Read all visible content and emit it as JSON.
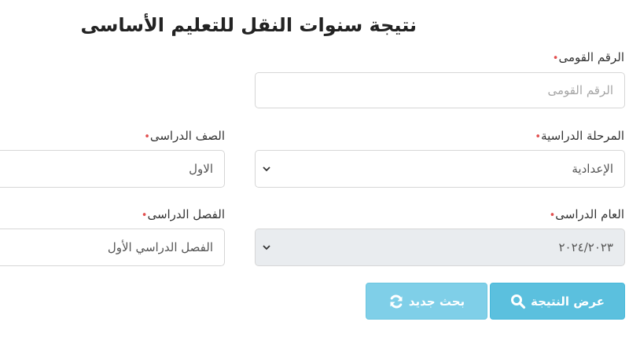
{
  "page": {
    "title": "نتيجة سنوات النقل للتعليم الأساسى"
  },
  "required_mark": "•",
  "fields": {
    "national_id": {
      "label": "الرقم القومى",
      "placeholder": "الرقم القومى",
      "value": ""
    },
    "stage": {
      "label": "المرحلة الدراسية",
      "value": "الإعدادية",
      "options_visible": [
        "الإعدادية"
      ]
    },
    "grade": {
      "label": "الصف الدراسى",
      "value": "الاول"
    },
    "year": {
      "label": "العام الدراسى",
      "value": "٢٠٢٤/٢٠٢٣",
      "disabled": true
    },
    "term": {
      "label": "الفصل الدراسى",
      "value": "الفصل الدراسي الأول"
    }
  },
  "buttons": {
    "show_result": {
      "label": "عرض النتيجة",
      "icon": "search-icon"
    },
    "new_search": {
      "label": "بحث جديد",
      "icon": "refresh-icon"
    }
  },
  "colors": {
    "primary_button": "#5bc0de",
    "secondary_button": "#7fcfe8",
    "required": "#e25050",
    "disabled_field": "#e9ecef"
  }
}
